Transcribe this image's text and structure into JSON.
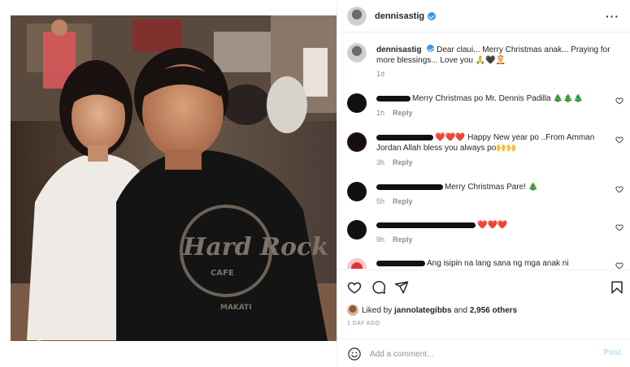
{
  "post": {
    "username": "dennisastig",
    "caption_username": "dennisastig",
    "caption_text": "Dear claui... Merry Christmas anak... Praying for more blessings... Love you 🙏🖤🤶",
    "caption_time": "1d"
  },
  "comments": [
    {
      "text": "Merry Christmas po Mr. Dennis Padilla 🎄🎄🎄",
      "time": "1h",
      "reply": "Reply"
    },
    {
      "text": "❤️❤️❤️ Happy New year po ..From Amman Jordan Allah bless you always po🙌🙌",
      "time": "3h",
      "reply": "Reply"
    },
    {
      "text": "Merry Christmas Pare! 🎄",
      "time": "5h",
      "reply": "Reply"
    },
    {
      "text": "❤️❤️❤️",
      "time": "9h",
      "reply": "Reply"
    },
    {
      "text": "Ang isipin na lang sana ng mga anak ni Marjorie",
      "time": "",
      "reply": ""
    }
  ],
  "likes": {
    "prefix": "Liked by",
    "user": "jannolategibbs",
    "and": "and",
    "count": "2,956 others"
  },
  "time_ago": "1 DAY AGO",
  "add_comment": {
    "placeholder": "Add a comment...",
    "post_label": "Post"
  },
  "colors": {
    "accent": "#3897f0",
    "post_disabled": "#b2dffc",
    "muted": "#8e8e8e",
    "border": "#efefef"
  }
}
